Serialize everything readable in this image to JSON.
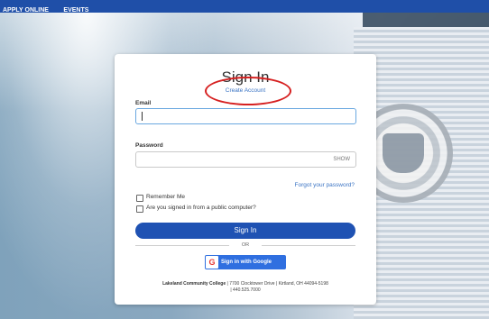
{
  "topnav": {
    "apply_online": "APPLY ONLINE",
    "events": "EVENTS"
  },
  "login": {
    "title": "Sign In",
    "create_account": "Create Account",
    "email_label": "Email",
    "email_value": "",
    "password_label": "Password",
    "password_value": "",
    "show_label": "SHOW",
    "forgot_password": "Forgot your password?",
    "remember_me": "Remember Me",
    "public_computer": "Are you signed in from a public computer?",
    "sign_in_button": "Sign In",
    "or_text": "OR",
    "google_label": "Sign in with Google",
    "google_icon_letter": "G"
  },
  "footer": {
    "college": "Lakeland Community College",
    "address": "| 7700 Clocktower Drive | Kirtland, OH 44094-5198",
    "phone": "| 440.525.7000"
  },
  "colors": {
    "topbar": "#1f4fa8",
    "primary_button": "#1f52b3",
    "link": "#3b74c4",
    "annotation_circle": "#d62020"
  },
  "icons": {
    "google": "google-icon"
  }
}
